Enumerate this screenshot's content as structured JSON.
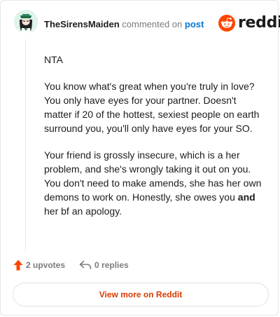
{
  "header": {
    "username": "TheSirensMaiden",
    "action_text": "commented on",
    "post_link": "post",
    "logo_text": "reddit"
  },
  "comment": {
    "paragraph_1": "NTA",
    "paragraph_2": "You know what's great when you're truly in love? You only have eyes for your partner. Doesn't matter if 20 of the hottest, sexiest people on earth surround you, you'll only have eyes for your SO.",
    "paragraph_3_before": "Your friend is grossly insecure, which is a her problem, and she's wrongly taking it out on you. You don't need to make amends, she has her own demons to work on. Honestly, she owes you ",
    "paragraph_3_bold": "and",
    "paragraph_3_after": " her bf an apology."
  },
  "actions": {
    "upvotes": "2 upvotes",
    "replies": "0 replies"
  },
  "footer": {
    "view_more_label": "View more on Reddit"
  },
  "colors": {
    "brand": "#ff4500",
    "link": "#0079d3",
    "view_more_text": "#d93a00"
  },
  "icons": [
    "avatar",
    "reddit-logo-icon",
    "upvote-arrow-icon",
    "reply-arrow-icon"
  ]
}
